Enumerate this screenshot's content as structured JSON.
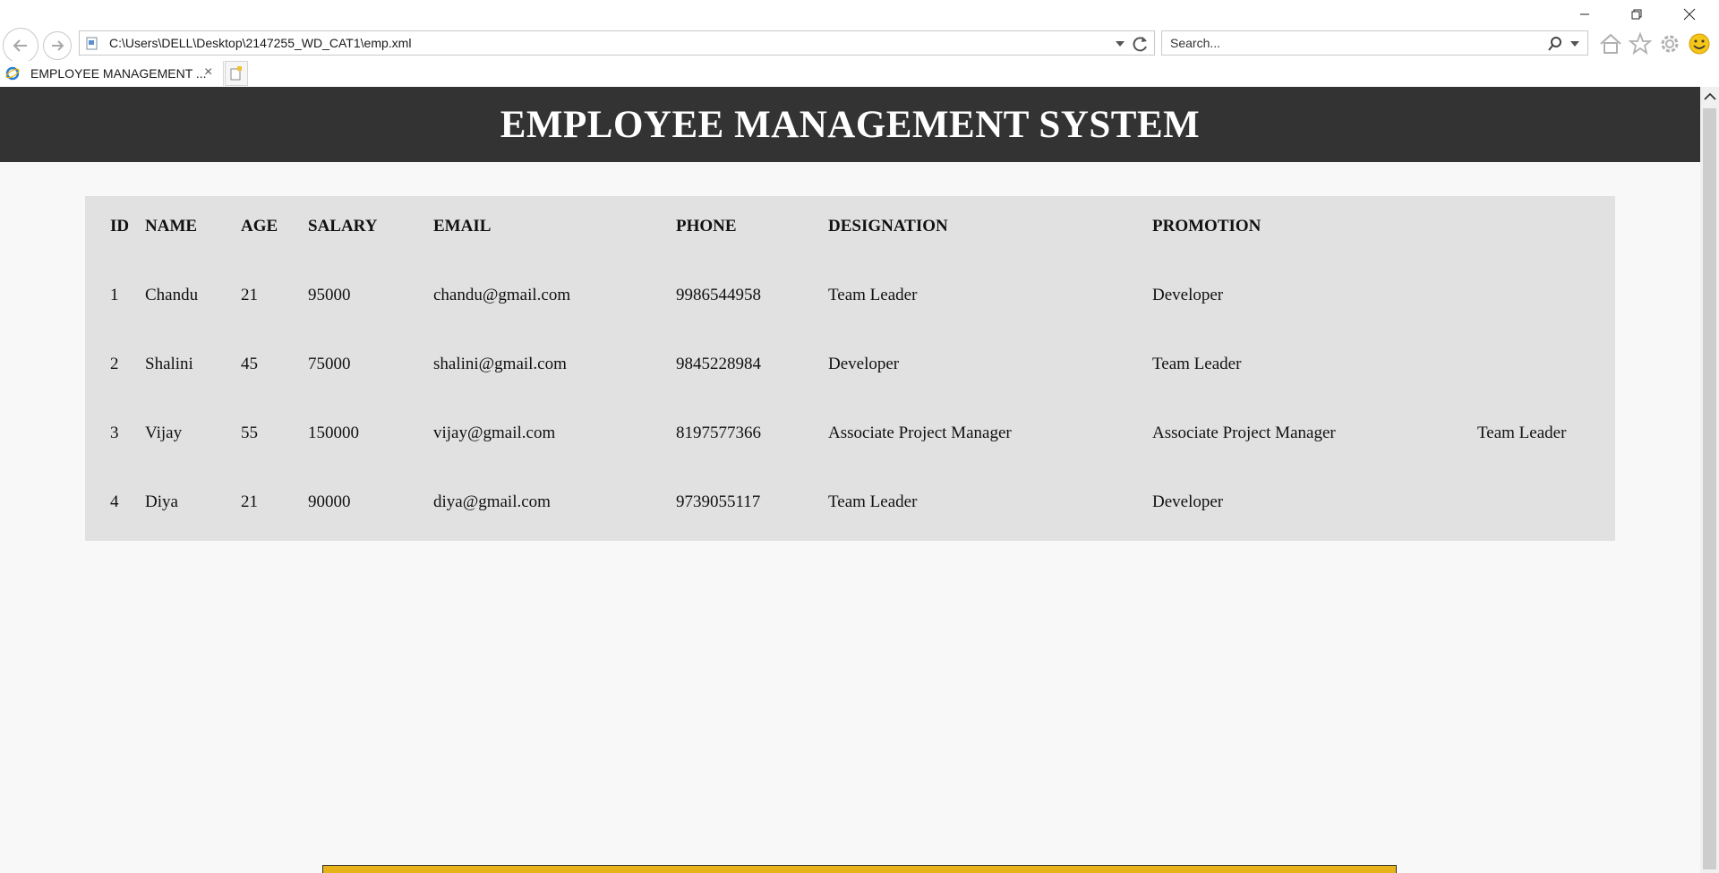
{
  "browser": {
    "address": "C:\\Users\\DELL\\Desktop\\2147255_WD_CAT1\\emp.xml",
    "search_placeholder": "Search...",
    "tab_title": "EMPLOYEE MANAGEMENT ...",
    "tab_close": "×"
  },
  "page": {
    "title": "EMPLOYEE MANAGEMENT SYSTEM"
  },
  "table": {
    "headers": [
      "ID",
      "NAME",
      "AGE",
      "SALARY",
      "EMAIL",
      "PHONE",
      "DESIGNATION",
      "PROMOTION"
    ],
    "rows": [
      {
        "id": "1",
        "name": "Chandu",
        "age": "21",
        "salary": "95000",
        "email": "chandu@gmail.com",
        "phone": "9986544958",
        "designation": "Team Leader",
        "promotion": "Developer",
        "extra": ""
      },
      {
        "id": "2",
        "name": "Shalini",
        "age": "45",
        "salary": "75000",
        "email": "shalini@gmail.com",
        "phone": "9845228984",
        "designation": "Developer",
        "promotion": "Team Leader",
        "extra": ""
      },
      {
        "id": "3",
        "name": "Vijay",
        "age": "55",
        "salary": "150000",
        "email": "vijay@gmail.com",
        "phone": "8197577366",
        "designation": "Associate Project Manager",
        "promotion": "Associate Project Manager",
        "extra": "Team Leader"
      },
      {
        "id": "4",
        "name": "Diya",
        "age": "21",
        "salary": "90000",
        "email": "diya@gmail.com",
        "phone": "9739055117",
        "designation": "Team Leader",
        "promotion": "Developer",
        "extra": ""
      }
    ]
  }
}
